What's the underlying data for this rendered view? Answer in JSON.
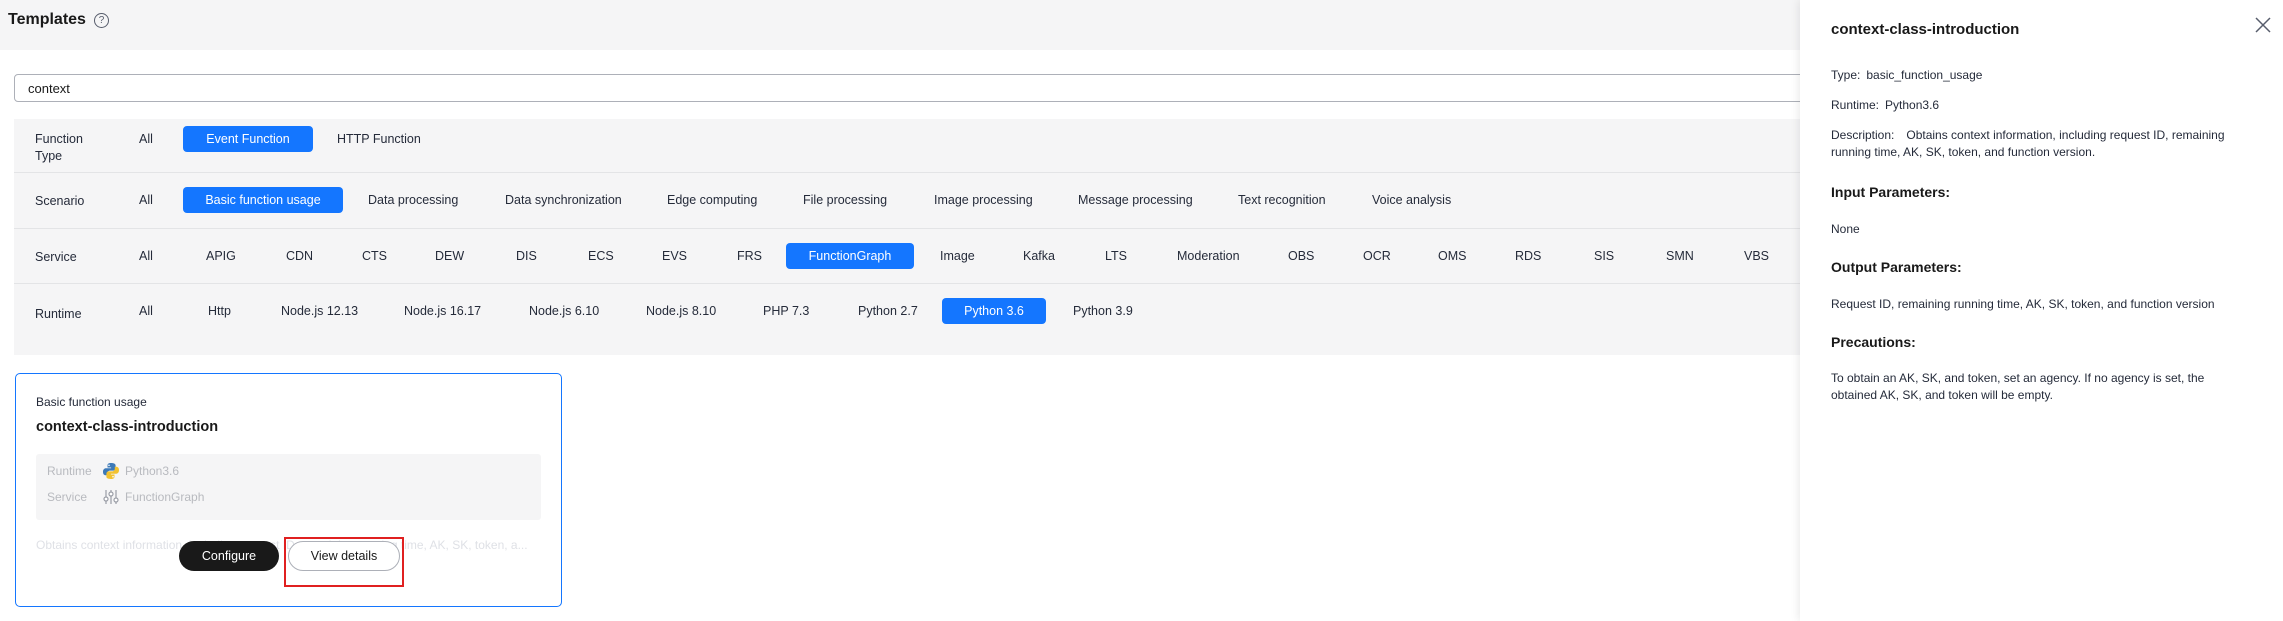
{
  "header": {
    "title": "Templates",
    "help_icon": "?"
  },
  "search": {
    "value": "context"
  },
  "filters": {
    "function_type": {
      "label": "Function Type",
      "label_line1": "Function",
      "label_line2": "Type",
      "options": [
        "All",
        "Event Function",
        "HTTP Function"
      ],
      "selected": "Event Function"
    },
    "scenario": {
      "label": "Scenario",
      "options": [
        "All",
        "Basic function usage",
        "Data processing",
        "Data synchronization",
        "Edge computing",
        "File processing",
        "Image processing",
        "Message processing",
        "Text recognition",
        "Voice analysis"
      ],
      "selected": "Basic function usage"
    },
    "service": {
      "label": "Service",
      "options": [
        "All",
        "APIG",
        "CDN",
        "CTS",
        "DEW",
        "DIS",
        "ECS",
        "EVS",
        "FRS",
        "FunctionGraph",
        "Image",
        "Kafka",
        "LTS",
        "Moderation",
        "OBS",
        "OCR",
        "OMS",
        "RDS",
        "SIS",
        "SMN",
        "VBS"
      ],
      "selected": "FunctionGraph"
    },
    "runtime": {
      "label": "Runtime",
      "options": [
        "All",
        "Http",
        "Node.js 12.13",
        "Node.js 16.17",
        "Node.js 6.10",
        "Node.js 8.10",
        "PHP 7.3",
        "Python 2.7",
        "Python 3.6",
        "Python 3.9"
      ],
      "selected": "Python 3.6"
    }
  },
  "card": {
    "category": "Basic function usage",
    "title": "context-class-introduction",
    "runtime_label": "Runtime",
    "runtime_value": "Python3.6",
    "service_label": "Service",
    "service_value": "FunctionGraph",
    "description": "Obtains context information, including request ID, remaining running time, AK, SK, token, a...",
    "configure_label": "Configure",
    "details_label": "View details"
  },
  "panel": {
    "title": "context-class-introduction",
    "type_label": "Type:",
    "type_value": "basic_function_usage",
    "runtime_label": "Runtime:",
    "runtime_value": "Python3.6",
    "description_label": "Description:",
    "description_value": "Obtains context information, including request ID, remaining running time, AK, SK, token, and function version.",
    "input_heading": "Input Parameters:",
    "input_value": "None",
    "output_heading": "Output Parameters:",
    "output_value": "Request ID, remaining running time, AK, SK, token, and function version",
    "precautions_heading": "Precautions:",
    "precautions_value": "To obtain an AK, SK, and token, set an agency. If no agency is set, the obtained AK, SK, and token will be empty."
  },
  "colors": {
    "accent": "#1476ff",
    "dark_button": "#191919",
    "highlight": "#e02020"
  }
}
